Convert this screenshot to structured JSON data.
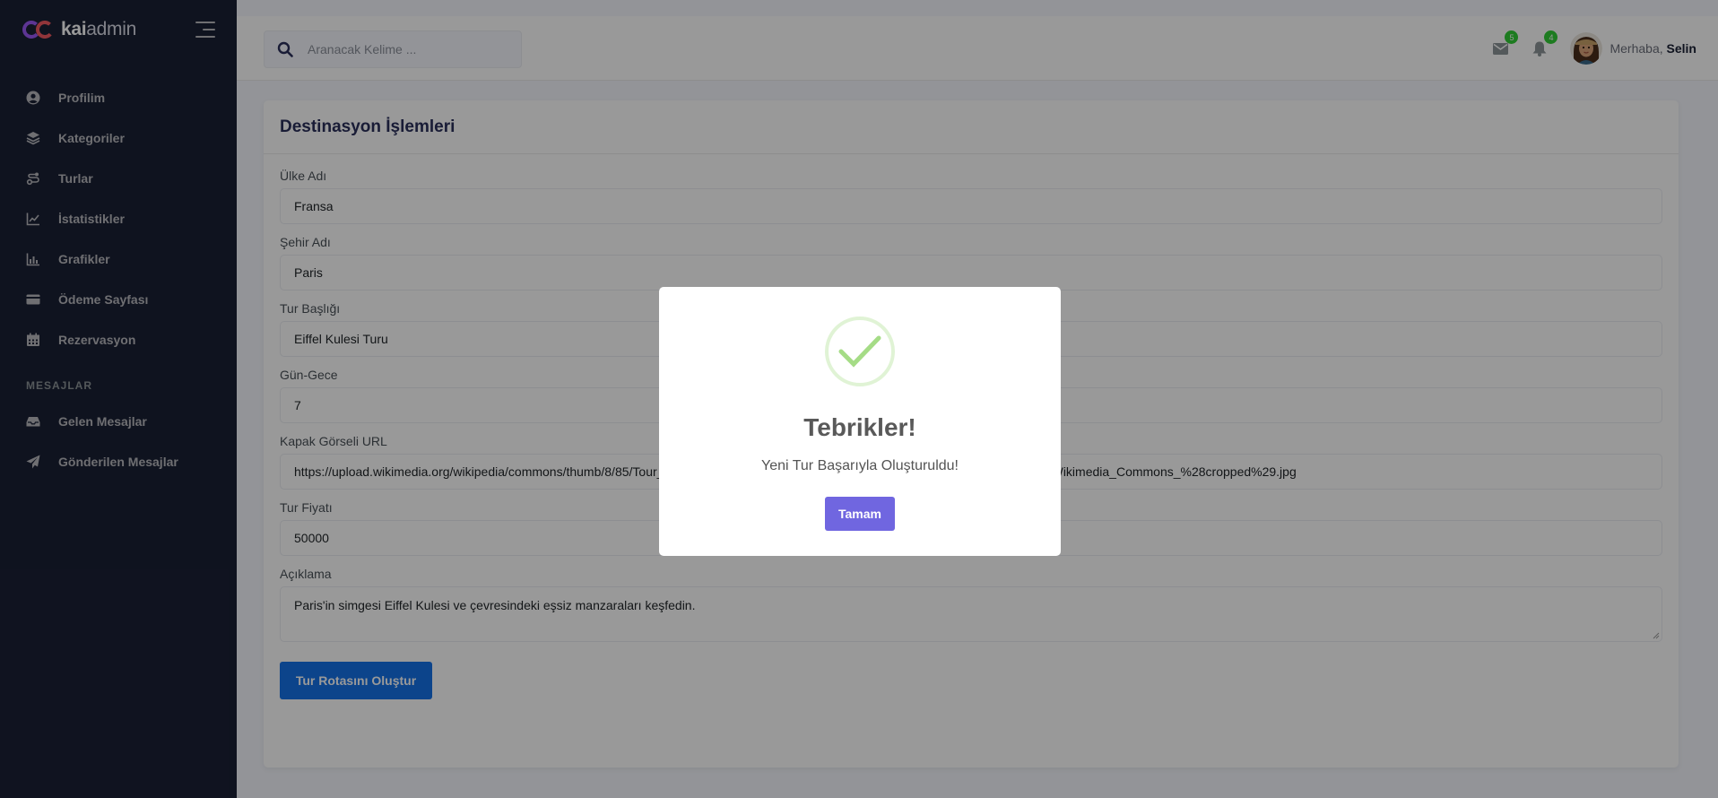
{
  "brand": {
    "name_bold": "kai",
    "name_light": "admin"
  },
  "sidebar": {
    "items": [
      {
        "label": "Profilim",
        "icon": "user-circle-icon"
      },
      {
        "label": "Kategoriler",
        "icon": "layers-icon"
      },
      {
        "label": "Turlar",
        "icon": "route-icon"
      },
      {
        "label": "İstatistikler",
        "icon": "line-chart-icon"
      },
      {
        "label": "Grafikler",
        "icon": "bar-chart-icon"
      },
      {
        "label": "Ödeme Sayfası",
        "icon": "credit-card-icon"
      },
      {
        "label": "Rezervasyon",
        "icon": "calendar-icon"
      }
    ],
    "section_label": "MESAJLAR",
    "message_items": [
      {
        "label": "Gelen Mesajlar",
        "icon": "inbox-icon"
      },
      {
        "label": "Gönderilen Mesajlar",
        "icon": "send-icon"
      }
    ]
  },
  "header": {
    "search_placeholder": "Aranacak Kelime ...",
    "messages_count": "5",
    "notifications_count": "4",
    "greeting": "Merhaba,",
    "user_name": "Selin"
  },
  "form": {
    "title": "Destinasyon İşlemleri",
    "fields": [
      {
        "label": "Ülke Adı",
        "value": "Fransa"
      },
      {
        "label": "Şehir Adı",
        "value": "Paris"
      },
      {
        "label": "Tur Başlığı",
        "value": "Eiffel Kulesi Turu"
      },
      {
        "label": "Gün-Gece",
        "value": "7"
      },
      {
        "label": "Kapak Görseli URL",
        "value": "https://upload.wikimedia.org/wikipedia/commons/thumb/8/85/Tour_Eiffel_Wikimedia_Commons_%28cropped%29.jpg/640px-Tour_Eiffel_Wikimedia_Commons_%28cropped%29.jpg"
      },
      {
        "label": "Tur Fiyatı",
        "value": "50000"
      }
    ],
    "description_label": "Açıklama",
    "description_value": "Paris'in simgesi Eiffel Kulesi ve çevresindeki eşsiz manzaraları keşfedin.",
    "submit_label": "Tur Rotasını Oluştur"
  },
  "modal": {
    "title": "Tebrikler!",
    "text": "Yeni Tur Başarıyla Oluşturuldu!",
    "button": "Tamam"
  },
  "colors": {
    "sidebar_bg": "#1a2035",
    "primary": "#1572e8",
    "modal_button": "#7066e0",
    "success": "#a5dc86",
    "badge": "#31ce36"
  }
}
